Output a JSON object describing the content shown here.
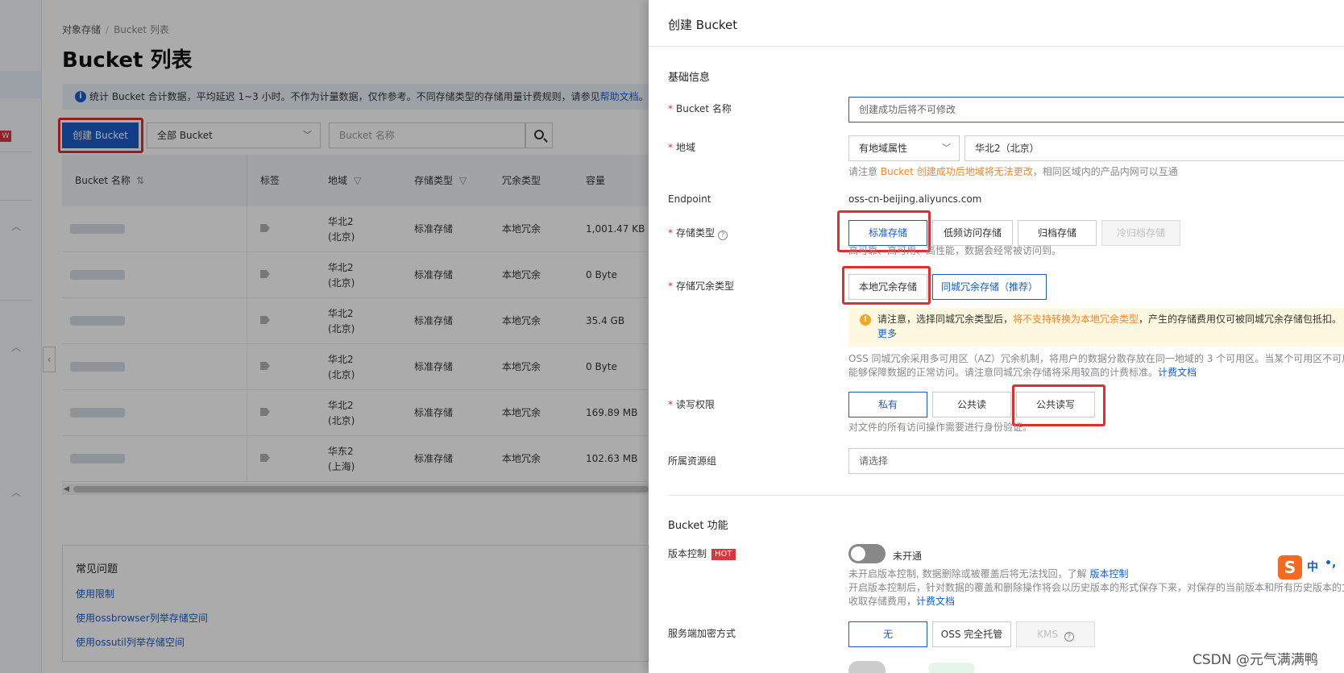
{
  "sidebar": {
    "badge": "W"
  },
  "page": {
    "breadcrumb": [
      "对象存储",
      "Bucket 列表"
    ],
    "title": "Bucket 列表",
    "info_text": "统计 Bucket 合计数据，平均延迟 1~3 小时。不作为计量数据，仅作参考。不同存储类型的存储用量计费规则，请参见",
    "info_link": "帮助文档",
    "info_tail": "。子",
    "create_button": "创建 Bucket",
    "filter_select": "全部 Bucket",
    "search_placeholder": "Bucket 名称"
  },
  "table": {
    "columns": [
      "Bucket 名称",
      "标签",
      "地域",
      "存储类型",
      "冗余类型",
      "容量"
    ],
    "rows": [
      {
        "region": [
          "华北2",
          "(北京)"
        ],
        "storage": "标准存储",
        "redundancy": "本地冗余",
        "capacity": "1,001.47 KB"
      },
      {
        "region": [
          "华北2",
          "(北京)"
        ],
        "storage": "标准存储",
        "redundancy": "本地冗余",
        "capacity": "0 Byte"
      },
      {
        "region": [
          "华北2",
          "(北京)"
        ],
        "storage": "标准存储",
        "redundancy": "本地冗余",
        "capacity": "35.4 GB"
      },
      {
        "region": [
          "华北2",
          "(北京)"
        ],
        "storage": "标准存储",
        "redundancy": "本地冗余",
        "capacity": "0 Byte"
      },
      {
        "region": [
          "华北2",
          "(北京)"
        ],
        "storage": "标准存储",
        "redundancy": "本地冗余",
        "capacity": "169.89 MB"
      },
      {
        "region": [
          "华东2",
          "(上海)"
        ],
        "storage": "标准存储",
        "redundancy": "本地冗余",
        "capacity": "102.63 MB"
      }
    ]
  },
  "faq": {
    "title": "常见问题",
    "links": [
      "使用限制",
      "使用ossbrowser列举存储空间",
      "使用ossutil列举存储空间"
    ]
  },
  "drawer": {
    "title": "创建 Bucket",
    "section_basic": "基础信息",
    "name_label": "Bucket 名称",
    "name_placeholder": "创建成功后将不可修改",
    "region_label": "地域",
    "region_attr": "有地域属性",
    "region_value": "华北2（北京）",
    "region_hint_pre": "请注意",
    "region_hint_org": "Bucket 创建成功后地域将无法更改",
    "region_hint_post": "，相同区域内的产品内网可以互通",
    "endpoint_label": "Endpoint",
    "endpoint_value": "oss-cn-beijing.aliyuncs.com",
    "storage_label": "存储类型",
    "storage_options": [
      "标准存储",
      "低频访问存储",
      "归档存储",
      "冷归档存储"
    ],
    "storage_hint": "高可靠、高可用、高性能，数据会经常被访问到。",
    "redundancy_label": "存储冗余类型",
    "redundancy_options": [
      "本地冗余存储",
      "同城冗余存储（推荐）"
    ],
    "warn_pre": "请注意，选择同城冗余类型后，",
    "warn_org": "将不支持转换为本地冗余类型",
    "warn_post": "，产生的存储费用仅可被同城冗余存储包抵扣。",
    "warn_more": "更多",
    "zrs_hint1": "OSS 同城冗余采用多可用区（AZ）冗余机制，将用户的数据分散存放在同一地域的 3 个可用区。当某个可用区不可用",
    "zrs_hint2": "能够保障数据的正常访问。请注意同城冗余存储将采用较高的计费标准。",
    "zrs_link": "计费文档",
    "acl_label": "读写权限",
    "acl_options": [
      "私有",
      "公共读",
      "公共读写"
    ],
    "acl_hint": "对文件的所有访问操作需要进行身份验证。",
    "rg_label": "所属资源组",
    "rg_placeholder": "请选择",
    "section_features": "Bucket 功能",
    "versioning_label": "版本控制",
    "hot_badge": "HOT",
    "versioning_state": "未开通",
    "ver_hint1": "未开启版本控制, 数据删除或被覆盖后将无法找回，了解",
    "ver_hint1_link": "版本控制",
    "ver_hint2": "开启版本控制后，针对数据的覆盖和删除操作将会以历史版本的形式保存下来，对保存的当前版本和所有历史版本的文",
    "ver_hint3": "收取存储费用，",
    "ver_hint3_link": "计费文档",
    "encrypt_label": "服务端加密方式",
    "encrypt_options": [
      "无",
      "OSS 完全托管",
      "KMS"
    ]
  },
  "ime": {
    "logo": "S",
    "lang": "中",
    "punct": "•,"
  },
  "watermark": "CSDN @元气满满鸭"
}
